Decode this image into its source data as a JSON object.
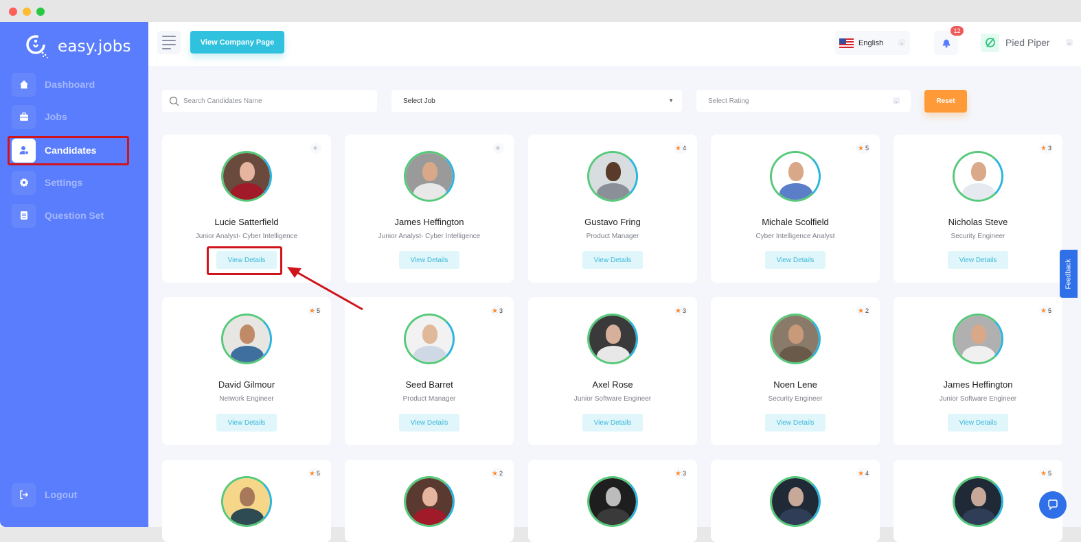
{
  "app": {
    "logo_text": "easy.jobs"
  },
  "sidebar": {
    "items": [
      {
        "label": "Dashboard",
        "icon": "home-icon",
        "active": false
      },
      {
        "label": "Jobs",
        "icon": "briefcase-icon",
        "active": false
      },
      {
        "label": "Candidates",
        "icon": "user-icon",
        "active": true
      },
      {
        "label": "Settings",
        "icon": "gear-icon",
        "active": false
      },
      {
        "label": "Question Set",
        "icon": "clipboard-icon",
        "active": false
      }
    ],
    "logout_label": "Logout"
  },
  "topbar": {
    "view_company_label": "View Company Page",
    "language": "English",
    "notification_count": "12",
    "company_name": "Pied Piper"
  },
  "filters": {
    "search_placeholder": "Search Candidates Name",
    "search_value": "",
    "job_select": "Select Job",
    "rating_select": "Select Rating",
    "reset_label": "Reset"
  },
  "candidates": [
    {
      "name": "Lucie Satterfield",
      "role": "Junior Analyst- Cyber Intelligence",
      "rating": "",
      "button": "View Details",
      "bg": "#6b4a3e",
      "face": "#e6b59f",
      "body": "#a01a2a"
    },
    {
      "name": "James Heffington",
      "role": "Junior Analyst- Cyber Intelligence",
      "rating": "",
      "button": "View Details",
      "bg": "#9a9a9a",
      "face": "#d9a888",
      "body": "#e8e8e8"
    },
    {
      "name": "Gustavo Fring",
      "role": "Product Manager",
      "rating": "4",
      "button": "View Details",
      "bg": "#d8dde0",
      "face": "#5a3a28",
      "body": "#8a8f98"
    },
    {
      "name": "Michale Scolfield",
      "role": "Cyber Intelligence Analyst",
      "rating": "5",
      "button": "View Details",
      "bg": "#ffffff",
      "face": "#d8a888",
      "body": "#5b7ec8"
    },
    {
      "name": "Nicholas Steve",
      "role": "Security Engineer",
      "rating": "3",
      "button": "View Details",
      "bg": "#ffffff",
      "face": "#d9a98a",
      "body": "#e6eaf0"
    },
    {
      "name": "David Gilmour",
      "role": "Network Engineer",
      "rating": "5",
      "button": "View Details",
      "bg": "#e8e6e2",
      "face": "#c08a68",
      "body": "#3f6f9e"
    },
    {
      "name": "Seed Barret",
      "role": "Product Manager",
      "rating": "3",
      "button": "View Details",
      "bg": "#f2f2f2",
      "face": "#e0b89a",
      "body": "#cfd9e6"
    },
    {
      "name": "Axel Rose",
      "role": "Junior Software Engineer",
      "rating": "3",
      "button": "View Details",
      "bg": "#3a3a3a",
      "face": "#d6b09a",
      "body": "#e8e8e8"
    },
    {
      "name": "Noen Lene",
      "role": "Security Engineer",
      "rating": "2",
      "button": "View Details",
      "bg": "#8a7a6a",
      "face": "#c89a7a",
      "body": "#6a5a4a"
    },
    {
      "name": "James Heffington",
      "role": "Junior Software Engineer",
      "rating": "5",
      "button": "View Details",
      "bg": "#b0b0b0",
      "face": "#d9a888",
      "body": "#f0f0f0"
    },
    {
      "name": "",
      "role": "",
      "rating": "5",
      "button": "",
      "bg": "#f6d78a",
      "face": "#a8785a",
      "body": "#2e4a52"
    },
    {
      "name": "",
      "role": "",
      "rating": "2",
      "button": "",
      "bg": "#5a3a30",
      "face": "#e6b59f",
      "body": "#a01a2a"
    },
    {
      "name": "",
      "role": "",
      "rating": "3",
      "button": "",
      "bg": "#1e1e1e",
      "face": "#bcbcbc",
      "body": "#3a3a3a"
    },
    {
      "name": "",
      "role": "",
      "rating": "4",
      "button": "",
      "bg": "#1f2a36",
      "face": "#c8a898",
      "body": "#2f3e56"
    },
    {
      "name": "",
      "role": "",
      "rating": "5",
      "button": "",
      "bg": "#1f2a36",
      "face": "#c8a898",
      "body": "#2f3e56"
    }
  ],
  "feedback_label": "Feedback",
  "colors": {
    "sidebar_bg": "#597dfc",
    "accent_cyan": "#2fc1dd",
    "reset_orange": "#fe9a37",
    "star_orange": "#fe8a2a",
    "annotation_red": "#d0141b",
    "chat_blue": "#2f6fe8"
  }
}
